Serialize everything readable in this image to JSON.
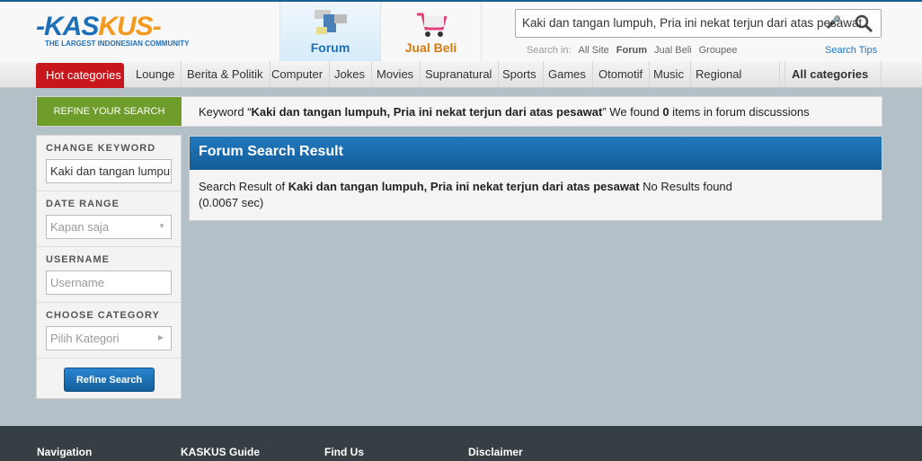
{
  "header": {
    "logo_text": "KASKUS",
    "logo_tagline": "THE LARGEST INDONESIAN COMMUNITY",
    "tabs": [
      {
        "label": "Forum",
        "active": true
      },
      {
        "label": "Jual Beli"
      }
    ],
    "search": {
      "value": "Kaki dan tangan lumpuh, Pria ini nekat terjun dari atas pesawat",
      "search_in_label": "Search in:",
      "scopes": [
        "All Site",
        "Forum",
        "Jual Beli",
        "Groupee"
      ],
      "active_scope": "Forum",
      "tips": "Search Tips"
    }
  },
  "nav": {
    "hot": "Hot categories",
    "items": [
      "Lounge",
      "Berita & Politik",
      "Computer",
      "Jokes",
      "Movies",
      "Supranatural",
      "Sports",
      "Games",
      "Otomotif",
      "Music",
      "Regional"
    ],
    "all": "All categories"
  },
  "refine": {
    "tab": "REFINE YOUR SEARCH",
    "pre": "Keyword “",
    "keyword": "Kaki dan tangan lumpuh, Pria ini nekat terjun dari atas pesawat",
    "mid": "” We found ",
    "count": "0",
    "post": " items in forum discussions"
  },
  "sidebar": {
    "keyword_label": "CHANGE KEYWORD",
    "keyword_value": "Kaki dan tangan lumpuh",
    "date_label": "DATE RANGE",
    "date_value": "Kapan saja",
    "user_label": "USERNAME",
    "user_placeholder": "Username",
    "cat_label": "CHOOSE CATEGORY",
    "cat_value": "Pilih Kategori",
    "button": "Refine Search"
  },
  "result": {
    "title": "Forum Search Result",
    "pre": "Search Result of ",
    "keyword": "Kaki dan tangan lumpuh, Pria ini nekat terjun dari atas pesawat",
    "post": " No Results found",
    "time": "(0.0067 sec)"
  },
  "footer": [
    "Navigation",
    "KASKUS Guide",
    "Find Us",
    "Disclaimer"
  ]
}
